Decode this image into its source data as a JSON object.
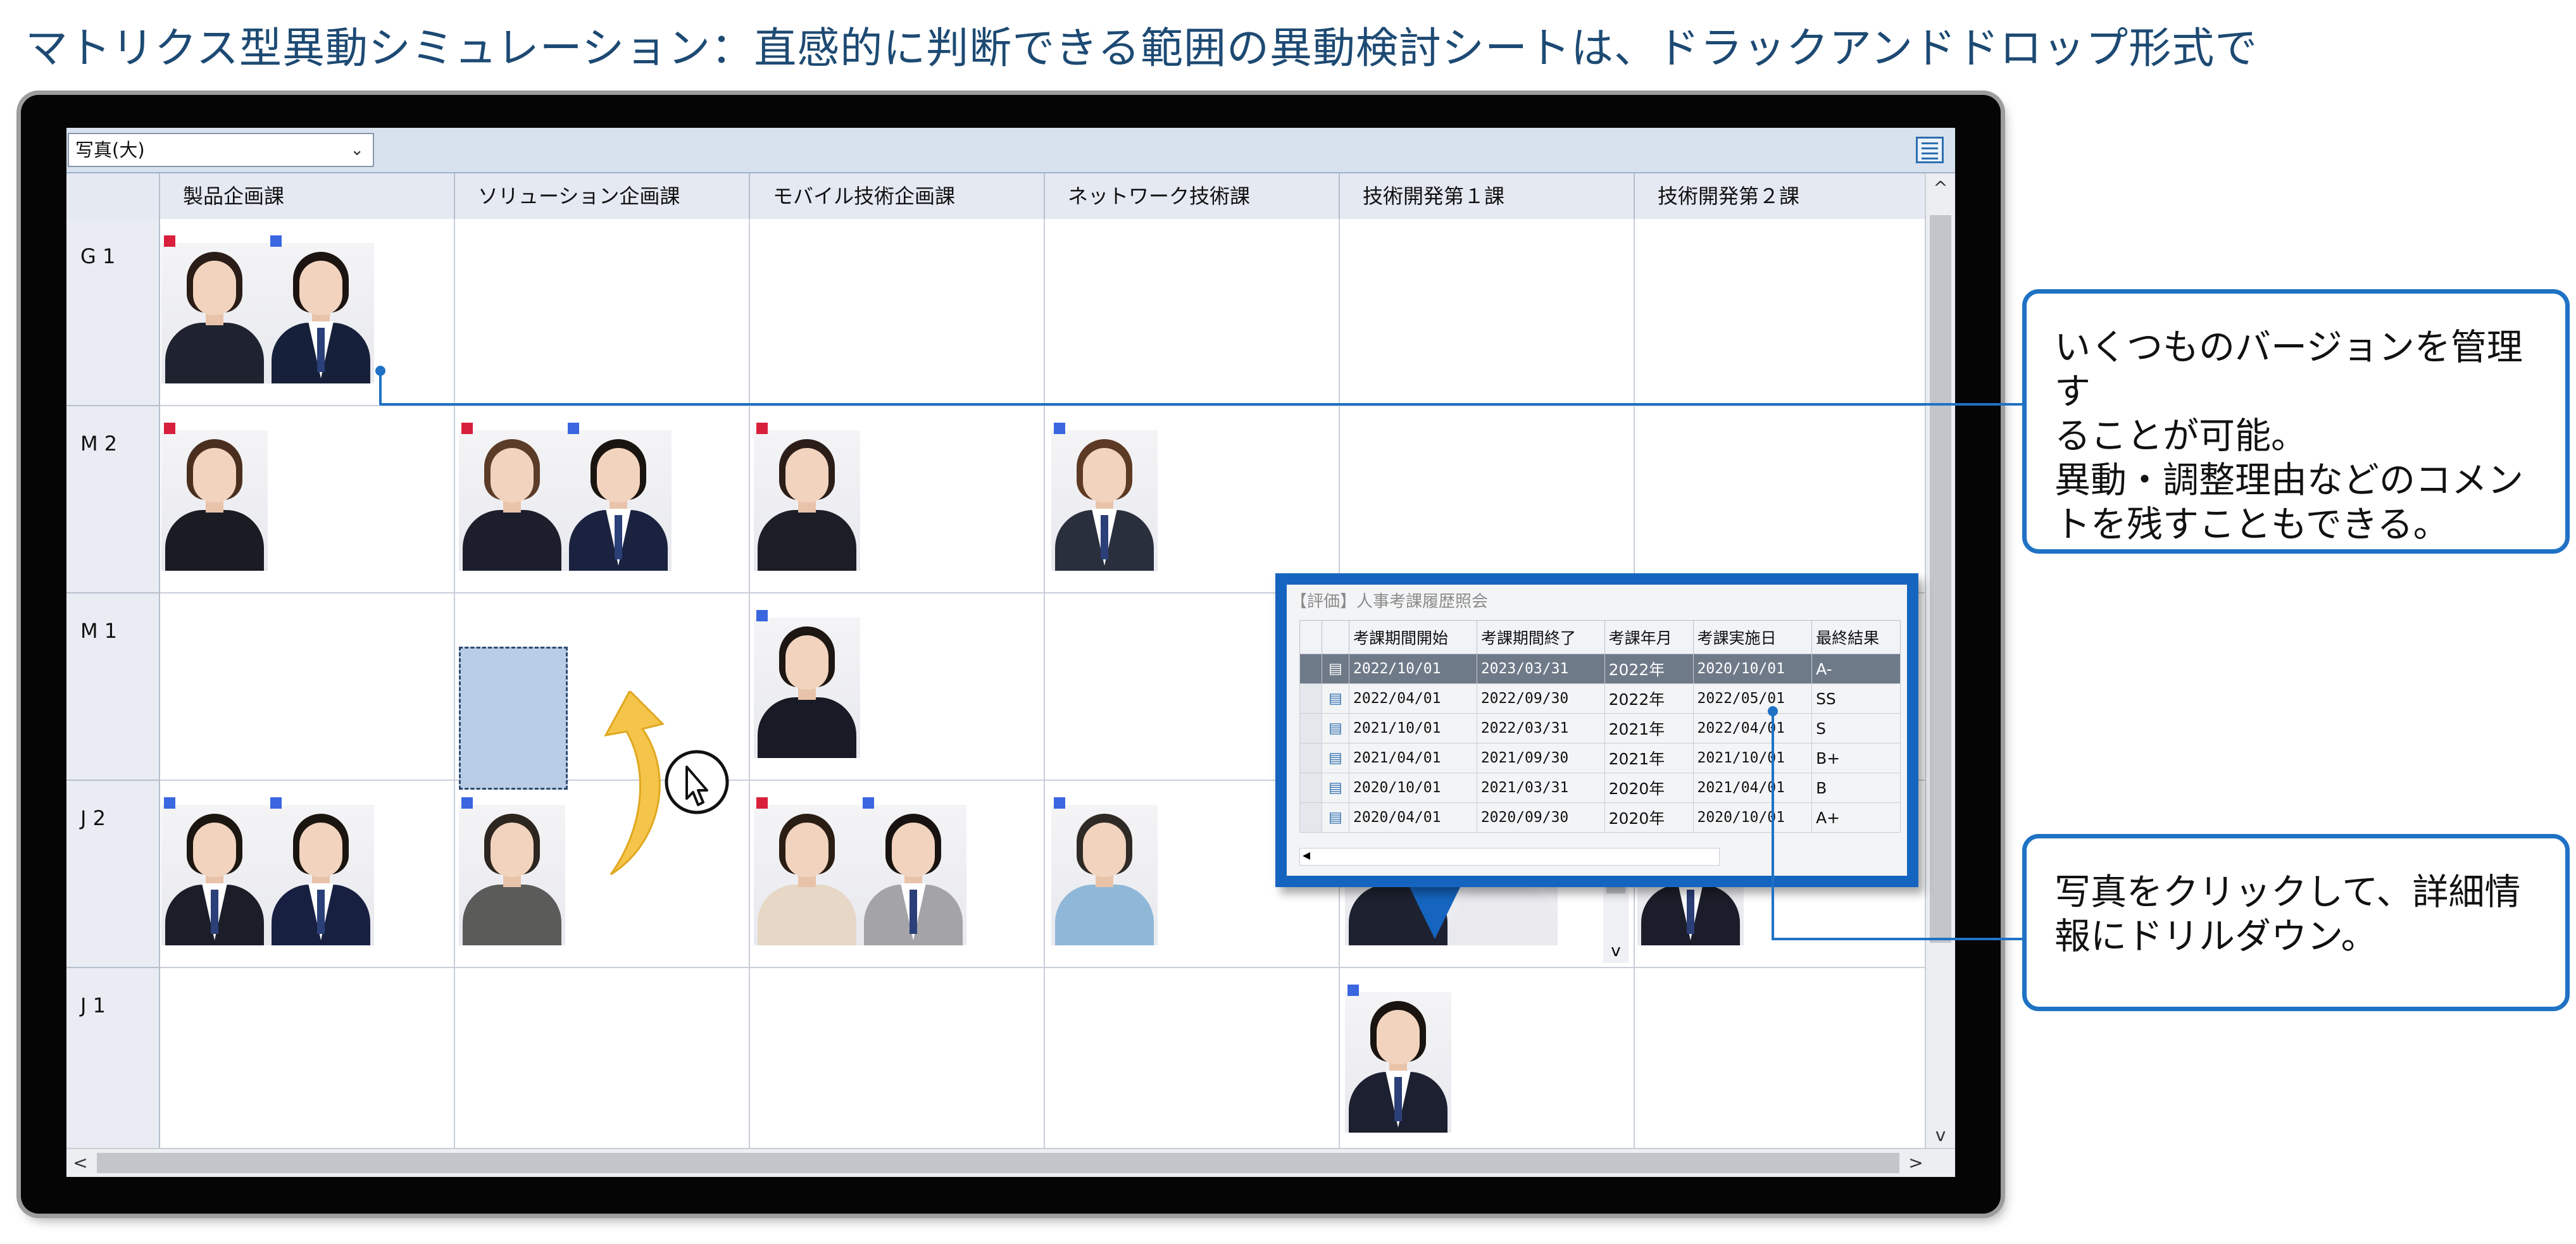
{
  "title": "マトリクス型異動シミュレーション：直感的に判断できる範囲の異動検討シートは、ドラックアンドドロップ形式で",
  "toolbar": {
    "view_select": "写真(大)",
    "grid_icon": "grid-icon"
  },
  "columns": [
    "製品企画課",
    "ソリューション企画課",
    "モバイル技術企画課",
    "ネットワーク技術課",
    "技術開発第１課",
    "技術開発第２課"
  ],
  "rows": [
    "G 1",
    "M 2",
    "M 1",
    "J 2",
    "J 1"
  ],
  "marker_colors": {
    "red": "#d8203d",
    "blue": "#3a66e0"
  },
  "popup": {
    "title": "【評価】人事考課履歴照会",
    "headers": [
      "考課期間開始",
      "考課期間終了",
      "考課年月",
      "考課実施日",
      "最終結果"
    ],
    "rows": [
      [
        "2022/10/01",
        "2023/03/31",
        "2022年",
        "2020/10/01",
        "A-"
      ],
      [
        "2022/04/01",
        "2022/09/30",
        "2022年",
        "2022/05/01",
        "SS"
      ],
      [
        "2021/10/01",
        "2022/03/31",
        "2021年",
        "2022/04/01",
        "S"
      ],
      [
        "2021/04/01",
        "2021/09/30",
        "2021年",
        "2021/10/01",
        "B+"
      ],
      [
        "2020/10/01",
        "2021/03/31",
        "2020年",
        "2021/04/01",
        "B"
      ],
      [
        "2020/04/01",
        "2020/09/30",
        "2020年",
        "2020/10/01",
        "A+"
      ]
    ]
  },
  "callouts": {
    "version_line1": "いくつものバージョンを管理す",
    "version_line2": "ることが可能。",
    "version_line3": "異動・調整理由などのコメン",
    "version_line4": "トを残すこともできる。",
    "drill_line1": "写真をクリックして、詳細情",
    "drill_line2": "報にドリルダウン。"
  },
  "scroll_arrows": {
    "up": "^",
    "down": "v",
    "left": "<",
    "right": ">"
  }
}
